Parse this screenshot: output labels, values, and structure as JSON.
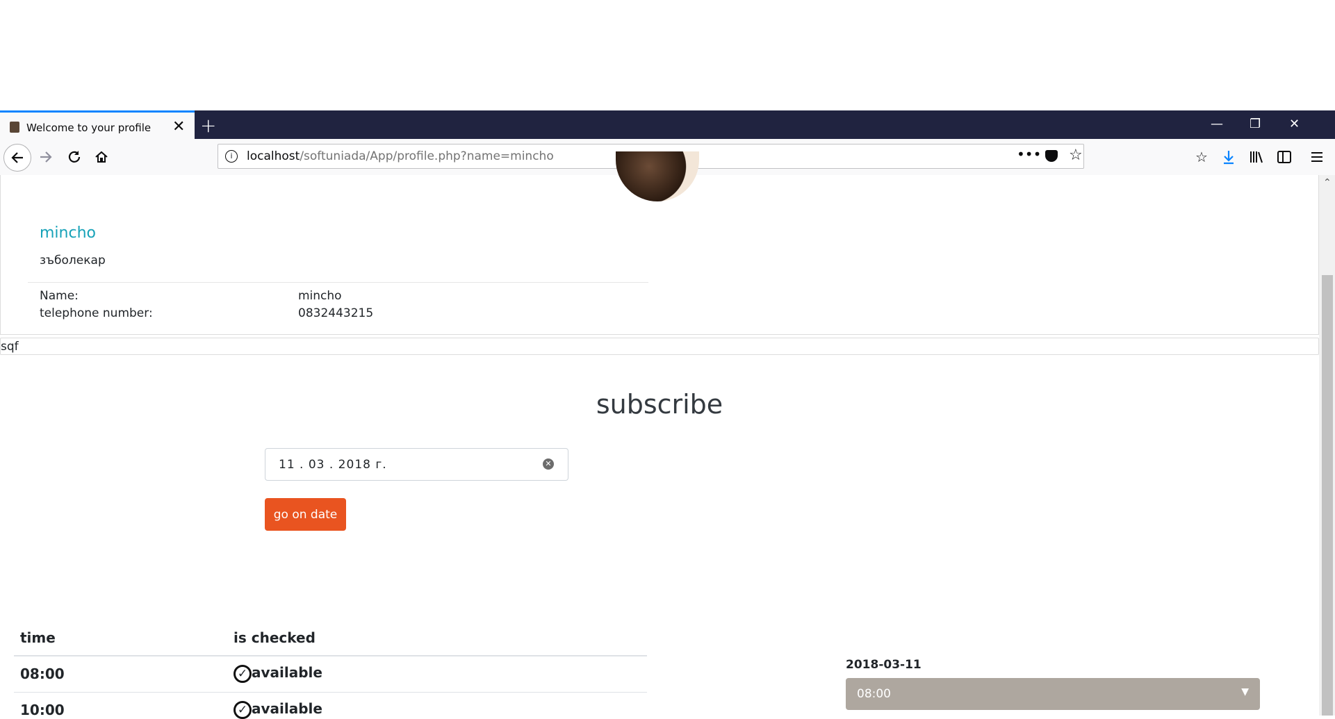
{
  "browser": {
    "tab_title": "Welcome to your profile",
    "tab_close": "✕",
    "new_tab": "+",
    "window_controls": {
      "minimize": "—",
      "restore": "❐",
      "close": "✕"
    },
    "url_host": "localhost",
    "url_path": "/softuniada/App/profile.php?name=mincho",
    "icons": [
      "back-icon",
      "forward-icon",
      "reload-icon",
      "home-icon",
      "info-icon",
      "page-actions-icon",
      "pocket-icon",
      "bookmark-star-icon",
      "bookmarks-icon",
      "downloads-icon",
      "library-icon",
      "sidebar-icon",
      "menu-icon"
    ]
  },
  "profile": {
    "name": "mincho",
    "profession": "зъболекар",
    "fields": [
      {
        "label": "Name:",
        "value": "mincho"
      },
      {
        "label": "telephone number:",
        "value": "0832443215"
      }
    ]
  },
  "note": "sqf",
  "subscribe": {
    "title": "subscribe",
    "date_value": "11 . 03 . 2018  г.",
    "button_label": "go on date"
  },
  "schedule_table": {
    "headers": [
      "time",
      "is checked"
    ],
    "rows": [
      {
        "time": "08:00",
        "status": "available"
      },
      {
        "time": "10:00",
        "status": "available"
      }
    ]
  },
  "booking": {
    "date": "2018-03-11",
    "selected_time": "08:00"
  },
  "colors": {
    "accent": "#e95420",
    "link": "#17a2b8",
    "select_bg": "#aea79f",
    "tabbar": "#202340"
  }
}
